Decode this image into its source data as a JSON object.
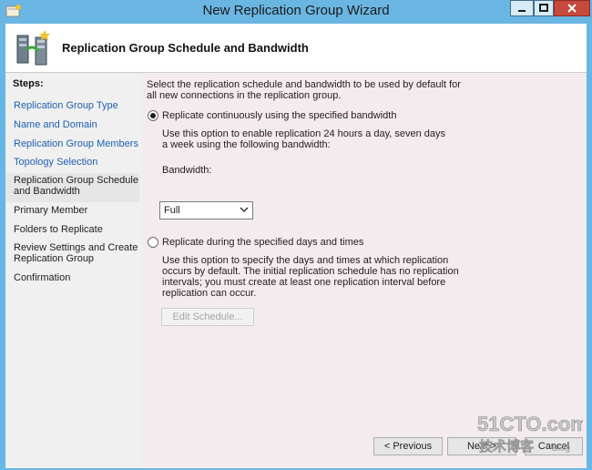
{
  "window": {
    "title": "New Replication Group Wizard"
  },
  "header": {
    "title": "Replication Group Schedule and Bandwidth"
  },
  "steps": {
    "title": "Steps:",
    "items": [
      {
        "label": "Replication Group Type"
      },
      {
        "label": "Name and Domain"
      },
      {
        "label": "Replication Group Members"
      },
      {
        "label": "Topology Selection"
      },
      {
        "label": "Replication Group Schedule and Bandwidth"
      },
      {
        "label": "Primary Member"
      },
      {
        "label": "Folders to Replicate"
      },
      {
        "label": "Review Settings and Create Replication Group"
      },
      {
        "label": "Confirmation"
      }
    ]
  },
  "content": {
    "intro": "Select the replication schedule and bandwidth to be used by default for all new connections in the replication group.",
    "option1": {
      "label": "Replicate continuously using the specified bandwidth",
      "description": "Use this option to enable replication 24 hours a day, seven days a week using the following bandwidth:",
      "selected": true
    },
    "bandwidth": {
      "label": "Bandwidth:",
      "value": "Full"
    },
    "option2": {
      "label": "Replicate during the specified days and times",
      "description": "Use this option to specify the days and times at which replication occurs by default. The initial replication schedule has no replication intervals; you must create at least one replication interval before replication can occur.",
      "selected": false
    },
    "edit_schedule": "Edit Schedule..."
  },
  "footer": {
    "previous": "< Previous",
    "next": "Next >",
    "cancel": "Cancel"
  },
  "watermark": {
    "brand": "51CTO.com",
    "sub": "技术博客",
    "blog": "Blog"
  },
  "colors": {
    "titlebar": "#6ab6e3",
    "link": "#1f5fb5",
    "content_bg": "#f4ebee",
    "close": "#c7493c"
  }
}
